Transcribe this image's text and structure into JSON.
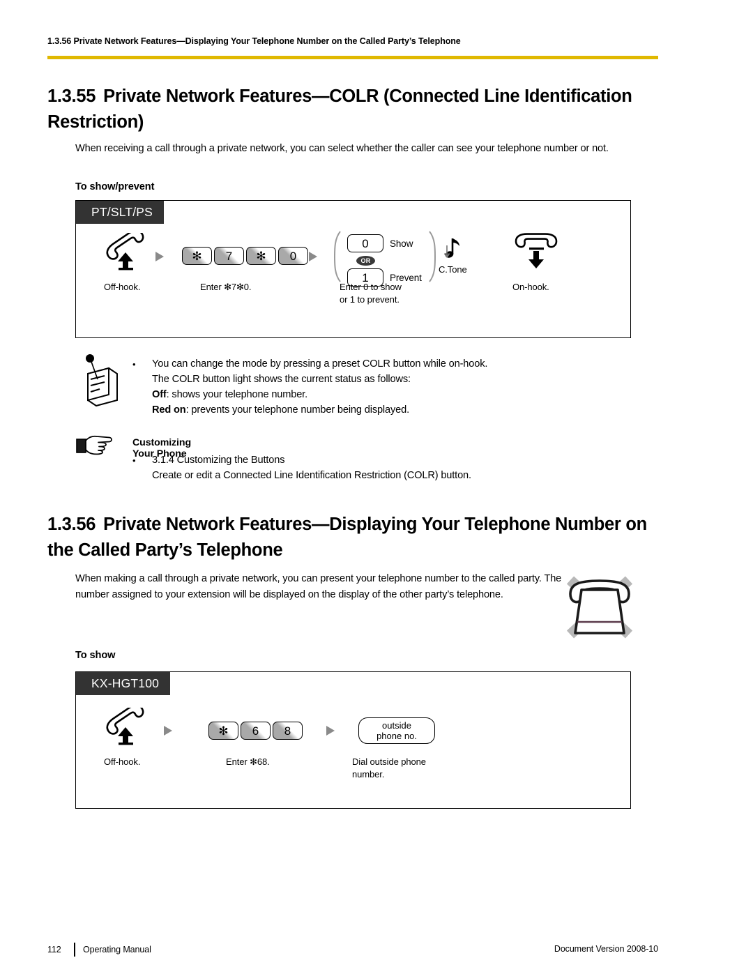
{
  "header": {
    "running_title": "1.3.56 Private Network Features—Displaying Your Telephone Number on the Called Party’s Telephone",
    "rule_color": "#e0b800"
  },
  "sections": [
    {
      "number": "1.3.55",
      "title": "Private Network Features—COLR (Connected Line Identification Restriction)",
      "intro": "When receiving a call through a private network, you can select whether the caller can see your telephone number or not.",
      "sub_head": "To show/prevent",
      "procedure": {
        "tab_label": "PT/SLT/PS",
        "steps": [
          {
            "icon": "offhook-handset-icon",
            "caption": "Off-hook."
          },
          {
            "icon": "dial-keys-icon",
            "keys": [
              "✻",
              "7",
              "✻",
              "0"
            ],
            "caption": "Enter ✻7✻0."
          },
          {
            "icon": "option-keys-icon",
            "option_a_key": "0",
            "option_a_label": "Show",
            "or_label": "OR",
            "option_b_key": "1",
            "option_b_label": "Prevent",
            "caption": "Enter 0 to show\nor 1 to prevent."
          },
          {
            "icon": "confirmation-tone-icon",
            "label": "C.Tone"
          },
          {
            "icon": "onhook-handset-icon",
            "caption": "On-hook."
          }
        ]
      },
      "note": {
        "icon": "note-pad-icon",
        "bullet": "•",
        "lines": [
          "You can change the mode by pressing a preset COLR button while on-hook.",
          "The COLR button light shows the current status as follows:"
        ],
        "status_off_label": "Off",
        "status_off_text": ": shows your telephone number.",
        "status_red_label": "Red on",
        "status_red_text": ": prevents your telephone number being displayed."
      },
      "customizing": {
        "icon": "pointing-hand-icon",
        "title": "Customizing Your Phone",
        "bullet": "•",
        "item": "3.1.4  Customizing the Buttons",
        "detail": "Create or edit a Connected Line Identification Restriction (COLR) button."
      }
    },
    {
      "number": "1.3.56",
      "title": "Private Network Features—Displaying Your Telephone Number on the Called Party’s Telephone",
      "intro": "When making a call through a private network, you can present your telephone number to the called party. The number assigned to your extension will be displayed on the display of the other party’s telephone.",
      "side_icon": "telephone-unavailable-icon",
      "sub_head": "To show",
      "procedure": {
        "tab_label": "KX-HGT100",
        "steps": [
          {
            "icon": "offhook-handset-icon",
            "caption": "Off-hook."
          },
          {
            "icon": "dial-keys-icon",
            "keys": [
              "✻",
              "6",
              "8"
            ],
            "caption": "Enter ✻68."
          },
          {
            "icon": "outside-number-box-icon",
            "box_line_1": "outside",
            "box_line_2": "phone no.",
            "caption": "Dial outside phone\nnumber."
          }
        ]
      }
    }
  ],
  "footer": {
    "page_number": "112",
    "manual_name": "Operating Manual",
    "document_version": "Document Version  2008-10"
  }
}
